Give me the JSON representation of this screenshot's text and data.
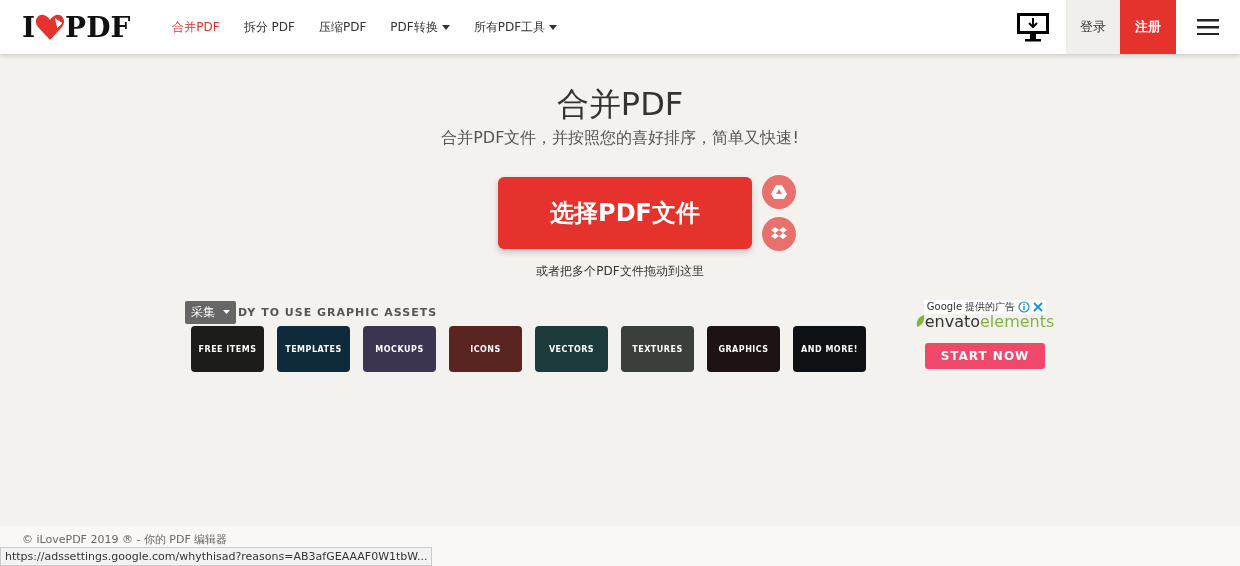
{
  "header": {
    "logo": {
      "left": "I",
      "right": "PDF"
    },
    "nav": [
      {
        "label": "合并PDF",
        "selected": true,
        "dropdown": false
      },
      {
        "label": "拆分 PDF",
        "selected": false,
        "dropdown": false
      },
      {
        "label": "压缩PDF",
        "selected": false,
        "dropdown": false
      },
      {
        "label": "PDF转换",
        "selected": false,
        "dropdown": true
      },
      {
        "label": "所有PDF工具",
        "selected": false,
        "dropdown": true
      }
    ],
    "login": "登录",
    "signup": "注册"
  },
  "hero": {
    "title": "合并PDF",
    "subtitle": "合并PDF文件，并按照您的喜好排序，简单又快速!",
    "button": "选择PDF文件",
    "drop_hint": "或者把多个PDF文件拖动到这里"
  },
  "ad": {
    "tooltip": "采集",
    "heading": "DY TO USE GRAPHIC ASSETS",
    "tiles": [
      {
        "label": "FREE ITEMS",
        "color": "#1c1d1a"
      },
      {
        "label": "TEMPLATES",
        "color": "#0f2a3a"
      },
      {
        "label": "MOCKUPS",
        "color": "#3b3550"
      },
      {
        "label": "ICONS",
        "color": "#5a2421"
      },
      {
        "label": "VECTORS",
        "color": "#1d3b3b"
      },
      {
        "label": "TEXTURES",
        "color": "#3a4039"
      },
      {
        "label": "GRAPHICS",
        "color": "#1d1214"
      },
      {
        "label": "AND MORE!",
        "color": "#0d1114"
      }
    ],
    "provider": "Google 提供的广告",
    "brand": "envato",
    "brand_suffix": "elements",
    "cta": "START NOW"
  },
  "footer": {
    "text": "© iLovePDF 2019 ® - 你的 PDF 编辑器"
  },
  "status_bar": {
    "url": "https://adssettings.google.com/whythisad?reasons=AB3afGEAAAF0W1tbW..."
  }
}
